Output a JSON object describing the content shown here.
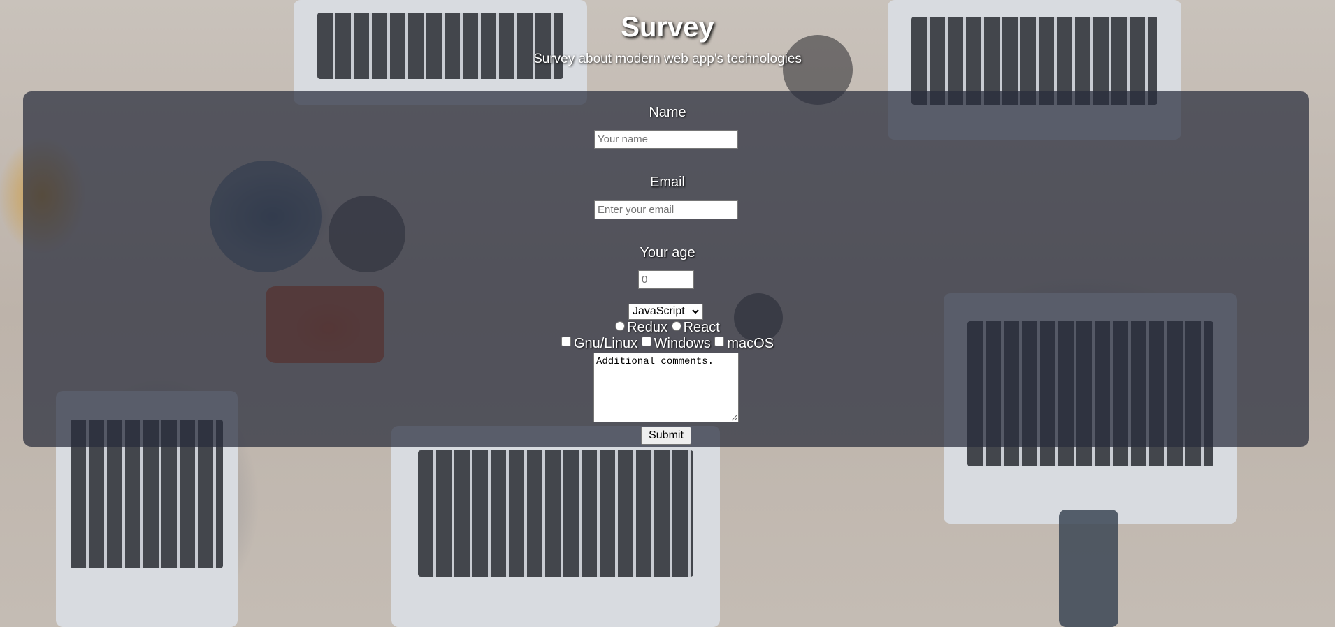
{
  "header": {
    "title": "Survey",
    "subtitle": "Survey about modern web app's technologies"
  },
  "form": {
    "name": {
      "label": "Name",
      "placeholder": "Your name"
    },
    "email": {
      "label": "Email",
      "placeholder": "Enter your email"
    },
    "age": {
      "label": "Your age",
      "placeholder": "0"
    },
    "select": {
      "selected": "JavaScript"
    },
    "radios": [
      {
        "label": "Redux"
      },
      {
        "label": "React"
      }
    ],
    "checkboxes": [
      {
        "label": "Gnu/Linux"
      },
      {
        "label": "Windows"
      },
      {
        "label": "macOS"
      }
    ],
    "comments": {
      "value": "Additional comments."
    },
    "submit_label": "Submit"
  },
  "colors": {
    "panel_overlay": "#282d3c",
    "text": "#ffffff"
  },
  "icons": {
    "select_chevron": "chevron-down-icon",
    "textarea_resize": "resize-grip-icon"
  }
}
